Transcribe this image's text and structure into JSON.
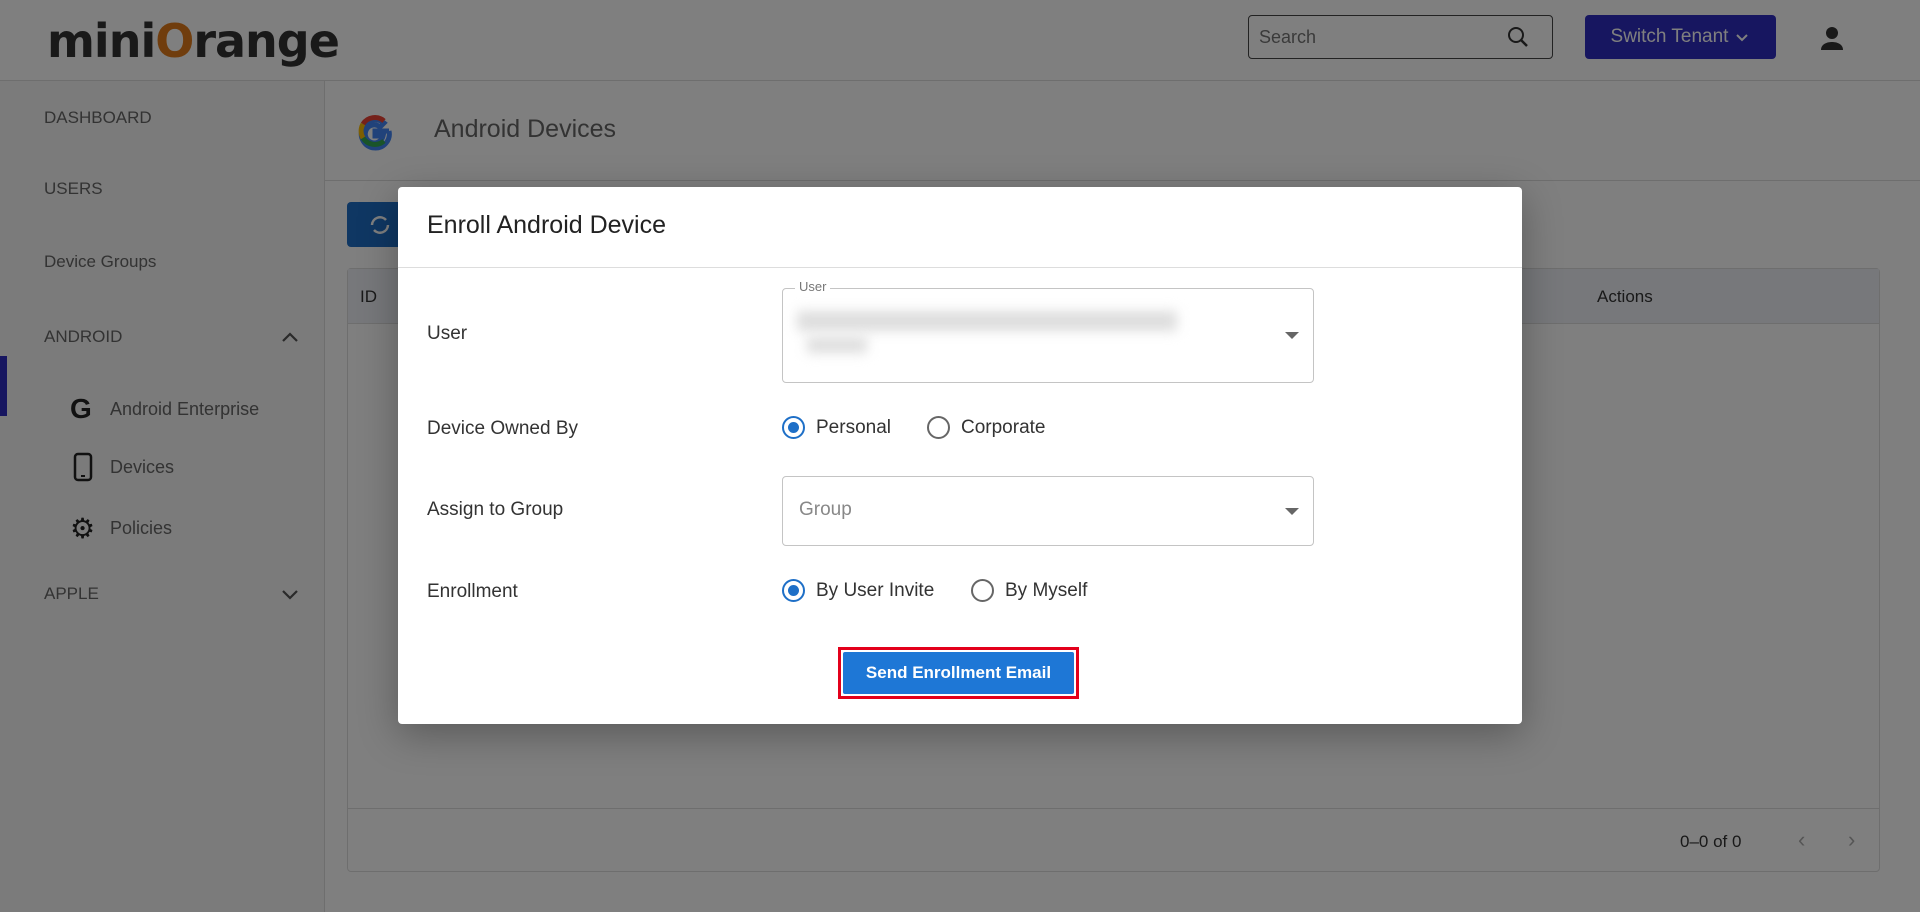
{
  "header": {
    "logo": "miniOrange",
    "logo_parts": [
      "mini",
      "O",
      "range"
    ],
    "search_placeholder": "Search",
    "switch_tenant": "Switch Tenant"
  },
  "sidebar": {
    "items": [
      {
        "label": "DASHBOARD"
      },
      {
        "label": "USERS"
      },
      {
        "label": "Device Groups"
      },
      {
        "label": "ANDROID"
      },
      {
        "label": "Android Enterprise",
        "icon": "google-icon"
      },
      {
        "label": "Devices",
        "icon": "phone-icon",
        "active": true
      },
      {
        "label": "Policies",
        "icon": "gear-icon"
      },
      {
        "label": "APPLE"
      }
    ]
  },
  "page": {
    "title": "Android Devices"
  },
  "table": {
    "columns": [
      "ID",
      "Actions"
    ],
    "pagination": "0–0 of 0"
  },
  "modal": {
    "title": "Enroll Android Device",
    "user_label": "User",
    "user_field_label": "User",
    "owned_label": "Device Owned By",
    "owned_options": [
      "Personal",
      "Corporate"
    ],
    "owned_selected": "Personal",
    "group_label": "Assign to Group",
    "group_placeholder": "Group",
    "enroll_label": "Enrollment",
    "enroll_options": [
      "By User Invite",
      "By Myself"
    ],
    "enroll_selected": "By User Invite",
    "send_button": "Send Enrollment Email"
  },
  "colors": {
    "accent": "#2f2cc0",
    "primary": "#1e77d6",
    "highlight": "#e3001b",
    "brand_orange": "#e07b1a"
  }
}
